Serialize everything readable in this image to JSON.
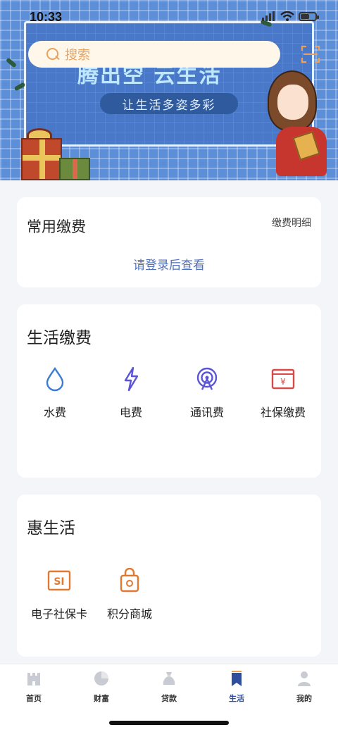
{
  "status_bar": {
    "time": "10:33"
  },
  "banner": {
    "title": "腾出空 云生活",
    "subtitle": "让生活多姿多彩"
  },
  "search": {
    "placeholder": "搜索"
  },
  "common_payment": {
    "title": "常用缴费",
    "detail_link": "缴费明细",
    "login_prompt": "请登录后查看"
  },
  "life_payment": {
    "title": "生活缴费",
    "items": [
      {
        "label": "水费",
        "icon": "water-drop-icon",
        "color": "#3a7bd5"
      },
      {
        "label": "电费",
        "icon": "lightning-icon",
        "color": "#5a55d6"
      },
      {
        "label": "通讯费",
        "icon": "signal-tower-icon",
        "color": "#5a55d6"
      },
      {
        "label": "社保缴费",
        "icon": "social-security-icon",
        "color": "#d64a4a"
      }
    ]
  },
  "benefit_life": {
    "title": "惠生活",
    "items": [
      {
        "label": "电子社保卡",
        "icon": "si-card-icon",
        "color": "#e07a33"
      },
      {
        "label": "积分商城",
        "icon": "shopping-bag-icon",
        "color": "#e07a33"
      }
    ]
  },
  "tab_bar": {
    "tabs": [
      {
        "label": "首页",
        "icon": "home-castle-icon",
        "active": false
      },
      {
        "label": "财富",
        "icon": "pie-chart-icon",
        "active": false
      },
      {
        "label": "贷款",
        "icon": "money-bag-icon",
        "active": false
      },
      {
        "label": "生活",
        "icon": "bookmark-icon",
        "active": true
      },
      {
        "label": "我的",
        "icon": "user-icon",
        "active": false
      }
    ]
  },
  "colors": {
    "accent": "#2f4e9e",
    "link": "#5270b8",
    "search_text": "#e9a15c"
  }
}
